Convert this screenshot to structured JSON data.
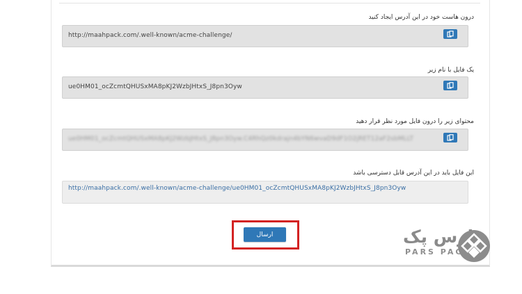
{
  "steps": [
    {
      "label": "درون هاست خود در این آدرس ایجاد کنید",
      "value": "http://maahpack.com/.well-known/acme-challenge/"
    },
    {
      "label": "یک فایل با نام زیر",
      "value": "ue0HM01_ocZcmtQHUSxMA8pKJ2WzbJHtxS_J8pn3Oyw"
    },
    {
      "label": "محتوای زیر را درون فایل مورد نظر قرار دهید",
      "value": "ue0HM01_ocZcmtQHUSxMA8pKJ2WzbJHtxS_J8pn3Oyw.C4RhQz0kdrajn4bYN6wvaD9dF1O2jRET12aF2sbMLLT"
    },
    {
      "label": "این فایل باید در این آدرس قابل دسترسی باشد",
      "value": "http://maahpack.com/.well-known/acme-challenge/ue0HM01_ocZcmtQHUSxMA8pKJ2WzbJHtxS_J8pn3Oyw"
    }
  ],
  "submit": {
    "label": "ارسال"
  },
  "brand": {
    "name_fa": "پارس پک",
    "name_en": "PARS PACK"
  },
  "icons": {
    "copy": "copy-icon",
    "logo": "parspack-logo-icon"
  },
  "colors": {
    "accent": "#2f78b7",
    "highlight": "#d32222",
    "field_bg": "#e2e2e2",
    "brand_gray": "#8c8c8c"
  }
}
